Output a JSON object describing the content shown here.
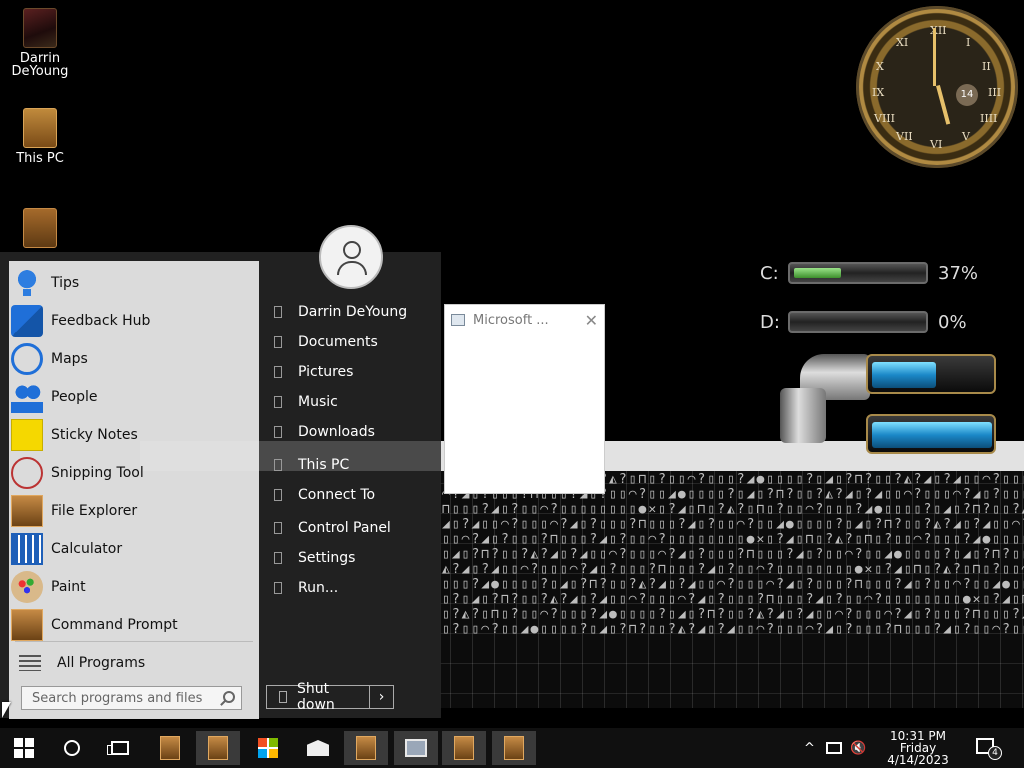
{
  "desktop": {
    "icons": [
      {
        "label": "Darrin DeYoung",
        "icon": "user-folder-icon"
      },
      {
        "label": "This PC",
        "icon": "computer-icon"
      },
      {
        "label": "",
        "icon": "recycle-bin-icon"
      }
    ],
    "clock": {
      "date_badge": "14",
      "numerals": [
        "XII",
        "I",
        "II",
        "III",
        "IIII",
        "V",
        "VI",
        "VII",
        "VIII",
        "IX",
        "X",
        "XI"
      ]
    },
    "drives": [
      {
        "label": "C:",
        "percent_text": "37%",
        "fill_fraction": 0.37
      },
      {
        "label": "D:",
        "percent_text": "0%",
        "fill_fraction": 0.0
      }
    ],
    "pattern_text": "▯▯▯▯▯▯▯▯●✕▯?◢▯⊓▯?◭?▯⊓▯?▯▯◠?▯▯▯?◢●▯▯▯▯?▯◢▯?⊓?▯▯?◭?◢▯?◢▯▯◠?▯▯▯◠?◢▯?▯▯▯?⊓▯▯▯?◢▯?▯▯◠?▯▯◢●▯▯▯▯?▯◢▯?⊓?▯▯?◭?◢▯?◢▯▯◠?▯▯▯◠?◢▯?▯▯▯?⊓▯▯▯?◢▯?▯▯◠?▯▯▯▯▯▯▯▯●✕▯?◢▯⊓▯?◭?▯⊓▯?▯▯◠?▯▯▯?◢●▯▯▯▯?▯◢▯?⊓?▯▯?◭?◢▯?◢▯▯◠?▯▯▯◠?◢▯?▯▯▯?⊓▯▯▯?◢▯?▯▯◠?▯▯◢●▯▯▯▯?▯◢▯?⊓?▯▯?◭?◢▯?◢▯▯◠?▯▯▯◠?◢▯?▯▯▯?⊓▯▯▯?◢▯?▯▯◠?▯▯▯▯▯▯▯▯●✕▯?◢▯⊓▯?◭?▯⊓▯?▯▯◠?▯▯▯?◢●▯▯▯▯?▯◢▯?⊓?▯▯?◭?◢▯?◢▯▯◠?▯▯▯◠?◢▯?▯▯▯?⊓▯▯▯?◢▯?▯▯◠?▯▯◢●▯▯▯▯?▯◢▯?⊓?▯▯?◭?◢▯?◢▯▯◠?▯▯▯◠?◢▯?▯▯▯?⊓▯▯▯?◢▯?▯▯◠?▯▯▯▯▯▯▯▯●✕▯?◢▯⊓▯?◭?▯⊓▯?▯▯◠?▯▯▯?◢●▯▯▯▯?▯◢▯?⊓?▯▯?◭?◢▯?◢▯▯◠?▯▯▯◠?◢▯?▯▯▯?⊓▯▯▯?◢▯?▯▯◠?▯▯◢●▯▯▯▯?▯◢▯?⊓?▯▯?◭?◢▯?◢▯▯◠?▯▯▯◠?◢▯?▯▯▯?⊓▯▯▯?◢▯?▯▯◠?▯▯▯▯▯▯▯▯●✕▯?◢▯⊓▯?◭?▯⊓▯?▯▯◠?▯▯▯?◢●▯▯▯▯?▯◢▯?⊓?▯▯?◭?◢▯?◢▯▯◠?▯▯▯◠?◢▯?▯▯▯?⊓▯▯▯?◢▯?▯▯◠?▯▯◢●▯▯▯▯?▯◢▯?⊓?▯▯?◭?◢▯?◢▯▯◠?▯▯▯◠?◢▯?▯▯▯?⊓▯▯▯?◢▯?▯▯◠?▯▯"
  },
  "ms_window": {
    "title": "Microsoft ...",
    "close": "✕"
  },
  "start_menu": {
    "programs": [
      {
        "label": "Tips",
        "icon": "lightbulb-icon"
      },
      {
        "label": "Feedback Hub",
        "icon": "feedback-hub-icon"
      },
      {
        "label": "Maps",
        "icon": "maps-icon"
      },
      {
        "label": "People",
        "icon": "people-icon"
      },
      {
        "label": "Sticky Notes",
        "icon": "sticky-notes-icon"
      },
      {
        "label": "Snipping Tool",
        "icon": "snipping-tool-icon"
      },
      {
        "label": "File Explorer",
        "icon": "file-explorer-icon"
      },
      {
        "label": "Calculator",
        "icon": "calculator-icon"
      },
      {
        "label": "Paint",
        "icon": "paint-palette-icon"
      },
      {
        "label": "Command Prompt",
        "icon": "command-prompt-icon"
      }
    ],
    "all_programs": "All Programs",
    "search_placeholder": "Search programs and files",
    "places": [
      {
        "label": "Darrin DeYoung"
      },
      {
        "label": "Documents"
      },
      {
        "label": "Pictures"
      },
      {
        "label": "Music"
      },
      {
        "label": "Downloads"
      },
      {
        "label": "This PC"
      },
      {
        "label": "Connect To"
      },
      {
        "label": "Control Panel"
      },
      {
        "label": "Settings"
      },
      {
        "label": "Run..."
      }
    ],
    "shutdown_label": "Shut down",
    "shutdown_arrow": "›"
  },
  "taskbar": {
    "time": "10:31 PM",
    "day": "Friday",
    "date": "4/14/2023",
    "notification_count": "4",
    "tray_chevron": "^",
    "volume_muted": "🔇"
  }
}
